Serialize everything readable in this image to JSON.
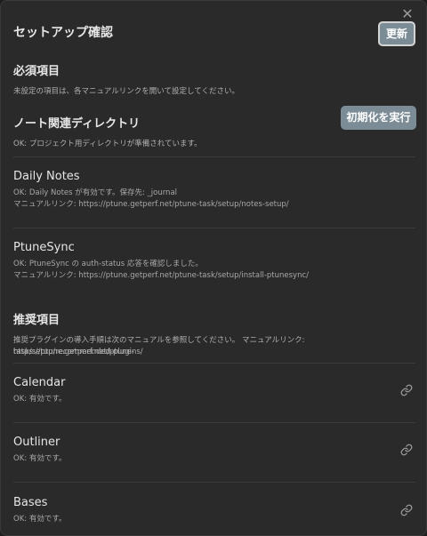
{
  "modal": {
    "title": "セットアップ確認",
    "refresh_button": "更新",
    "close_symbol": "✕"
  },
  "required": {
    "heading": "必須項目",
    "description": "未設定の項目は、各マニュアルリンクを開いて設定してください。",
    "note_dir": {
      "heading": "ノート関連ディレクトリ",
      "init_button": "初期化を実行",
      "status": "OK: プロジェクト用ディレクトリが準備されています。"
    },
    "items": [
      {
        "name": "Daily Notes",
        "status": "OK: Daily Notes が有効です。保存先: _journal",
        "manual": "マニュアルリンク: https://ptune.getperf.net/ptune-task/setup/notes-setup/"
      },
      {
        "name": "PtuneSync",
        "status": "OK: PtuneSync の auth-status 応答を確認しました。",
        "manual": "マニュアルリンク: https://ptune.getperf.net/ptune-task/setup/install-ptunesync/"
      }
    ]
  },
  "recommended": {
    "heading": "推奨項目",
    "description_line1": "推奨プラグインの導入手順は次のマニュアルを参照してください。 マニュアルリンク: https://ptune.getperf.net/ptune-",
    "description_line2": "task/setup/recommended-plugins/",
    "items": [
      {
        "name": "Calendar",
        "status": "OK: 有効です。",
        "icon": "link-icon"
      },
      {
        "name": "Outliner",
        "status": "OK: 有効です。",
        "icon": "link-icon"
      },
      {
        "name": "Bases",
        "status": "OK: 有効です。",
        "icon": "link-icon"
      }
    ]
  }
}
